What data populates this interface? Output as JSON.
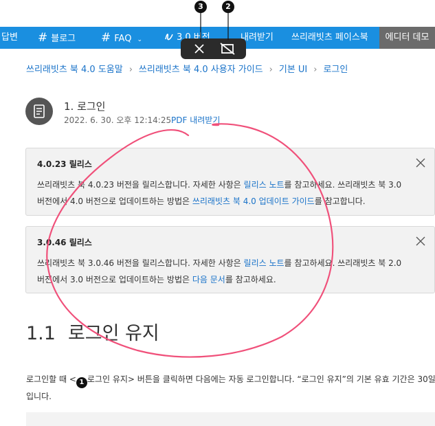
{
  "nav": {
    "items": [
      {
        "label": "답변",
        "hash": false
      },
      {
        "label": "블로그",
        "hash": true
      },
      {
        "label": "FAQ",
        "hash": true,
        "chevron": true
      },
      {
        "label": "3.0 버전",
        "hash": false,
        "icon": "scribble-icon"
      },
      {
        "label": "내려받기",
        "hash": false
      },
      {
        "label": "쓰리래빗츠 페이스북",
        "hash": false
      }
    ],
    "demo_label": "에디터 데모",
    "color": "#1a8fe0"
  },
  "toolbar": {
    "close_icon": "close-icon",
    "crop_icon": "crop-icon"
  },
  "markers": [
    "1",
    "2",
    "3"
  ],
  "breadcrumb": [
    "쓰리래빗츠 북 4.0 도움말",
    "쓰리래빗츠 북 4.0 사용자 가이드",
    "기본 UI",
    "로그인"
  ],
  "doc": {
    "title": "1. 로그인",
    "date": "2022. 6. 30. 오후 12:14:25",
    "pdf_label": "PDF 내려받기"
  },
  "notices": [
    {
      "title": "4.0.23 릴리스",
      "line1_pre": "쓰리래빗츠 북 4.0.23 버전을 릴리스합니다. 자세한 사항은 ",
      "line1_link": "릴리스 노트",
      "line1_post": "를 참고하세요. 쓰리래빗츠 북 3.0",
      "line2_pre": "버전에서 4.0 버전으로 업데이트하는 방법은 ",
      "line2_link": "쓰리래빗츠 북 4.0 업데이트 가이드",
      "line2_post": "를 참고합니다."
    },
    {
      "title": "3.0.46 릴리스",
      "line1_pre": "쓰리래빗츠 북 3.0.46 버전을 릴리스합니다. 자세한 사항은 ",
      "line1_link": "릴리스 노트",
      "line1_post": "를 참고하세요. 쓰리래빗츠 북 2.0",
      "line2_pre": "버전에서 3.0 버전으로 업데이트하는 방법은 ",
      "line2_link": "다음 문서",
      "line2_post": "를 참고하세요."
    }
  ],
  "section": {
    "number": "1.1",
    "title": "로그인 유지"
  },
  "body": {
    "pre": "로그인할 때 <",
    "post": "로그인 유지> 버튼을 클릭하면 다음에는 자동 로그인합니다. “로그인 유지”의 기본 유효 기간은 30일입니다."
  },
  "annotation_color": "#f0507a"
}
